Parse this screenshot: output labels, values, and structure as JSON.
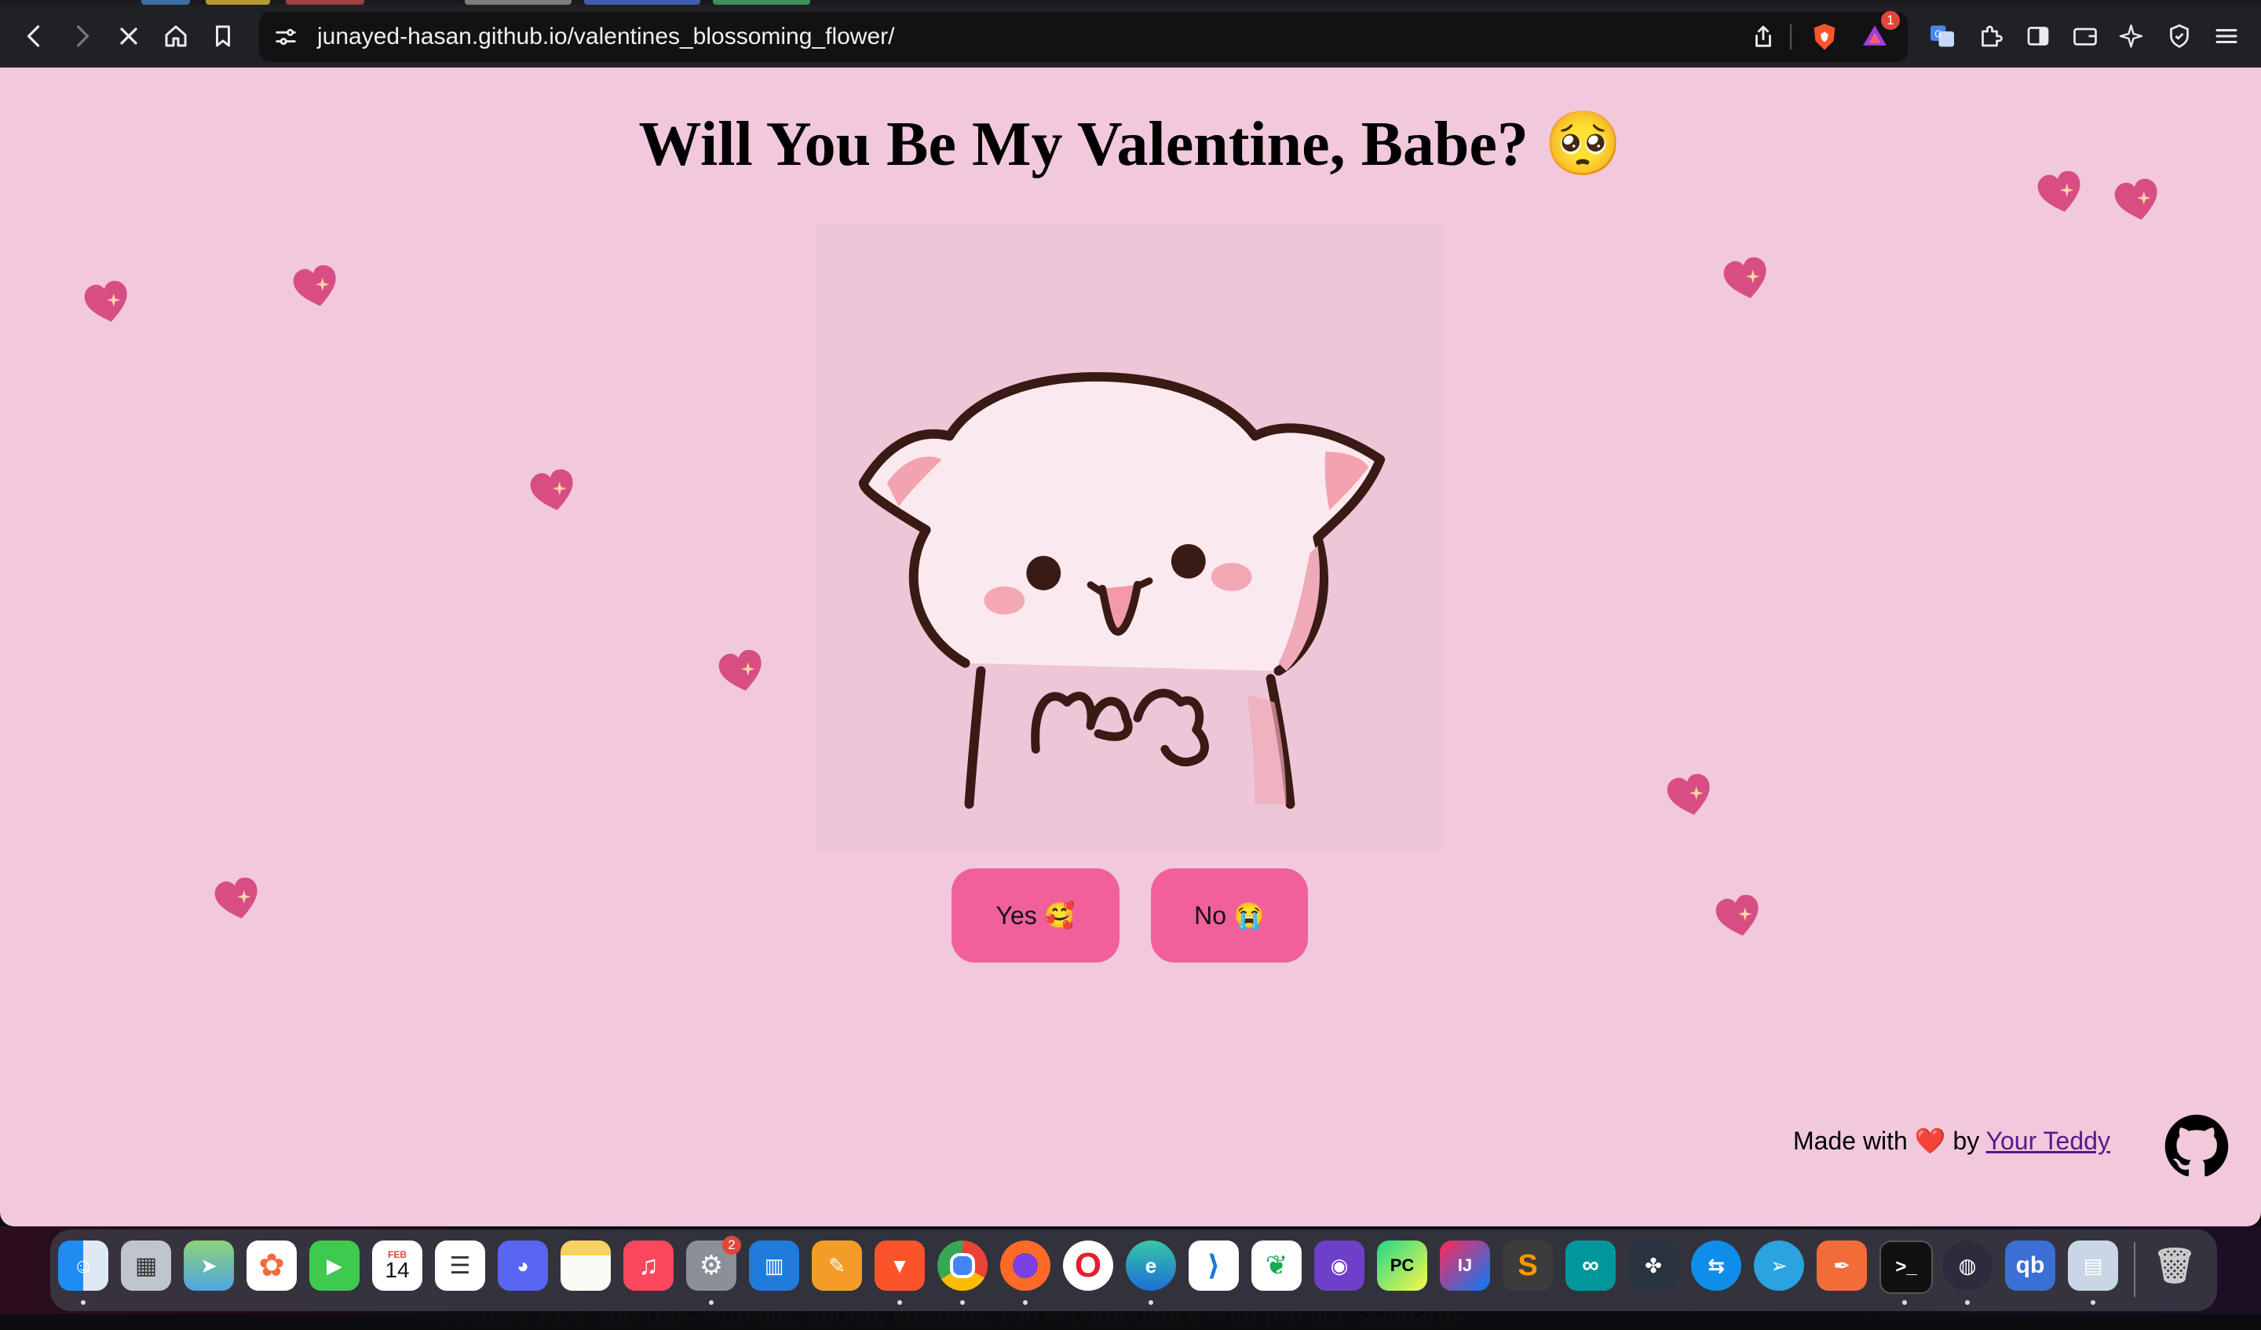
{
  "browser": {
    "url": "junayed-hasan.github.io/valentines_blossoming_flower/",
    "rewards_badge": "1",
    "tab_colors": [
      "#3b6ea5",
      "#b99a2e",
      "#a04040",
      "#7d7d7d",
      "#3f5fb0",
      "#3f8f5a"
    ]
  },
  "page": {
    "title": "Will You Be My Valentine, Babe? 🥺",
    "yes_label": "Yes 🥰",
    "no_label": "No 😭",
    "footer_prefix": "Made with ❤️ by",
    "footer_link": "Your Teddy",
    "background_color": "#f1c8dc",
    "button_color": "#f0609b"
  },
  "dock": {
    "calendar_month": "FEB",
    "calendar_day": "14",
    "settings_badge": "2",
    "apps": [
      "finder",
      "launchpad",
      "maps",
      "photos",
      "facetime",
      "calendar",
      "reminders",
      "discord",
      "notes",
      "music",
      "system-settings",
      "trello",
      "pages",
      "brave",
      "chrome",
      "firefox",
      "opera",
      "edge",
      "vscode",
      "mongodb-compass",
      "github-desktop",
      "pycharm",
      "intellij",
      "sublime-text",
      "arduino",
      "davinci-resolve",
      "teamviewer",
      "telegram",
      "sketch",
      "terminal",
      "obs",
      "qbittorrent",
      "preview",
      "trash"
    ]
  },
  "behind_text": "Secured PDF and files with encryption, ensuring 100% compliance with privacy standards"
}
